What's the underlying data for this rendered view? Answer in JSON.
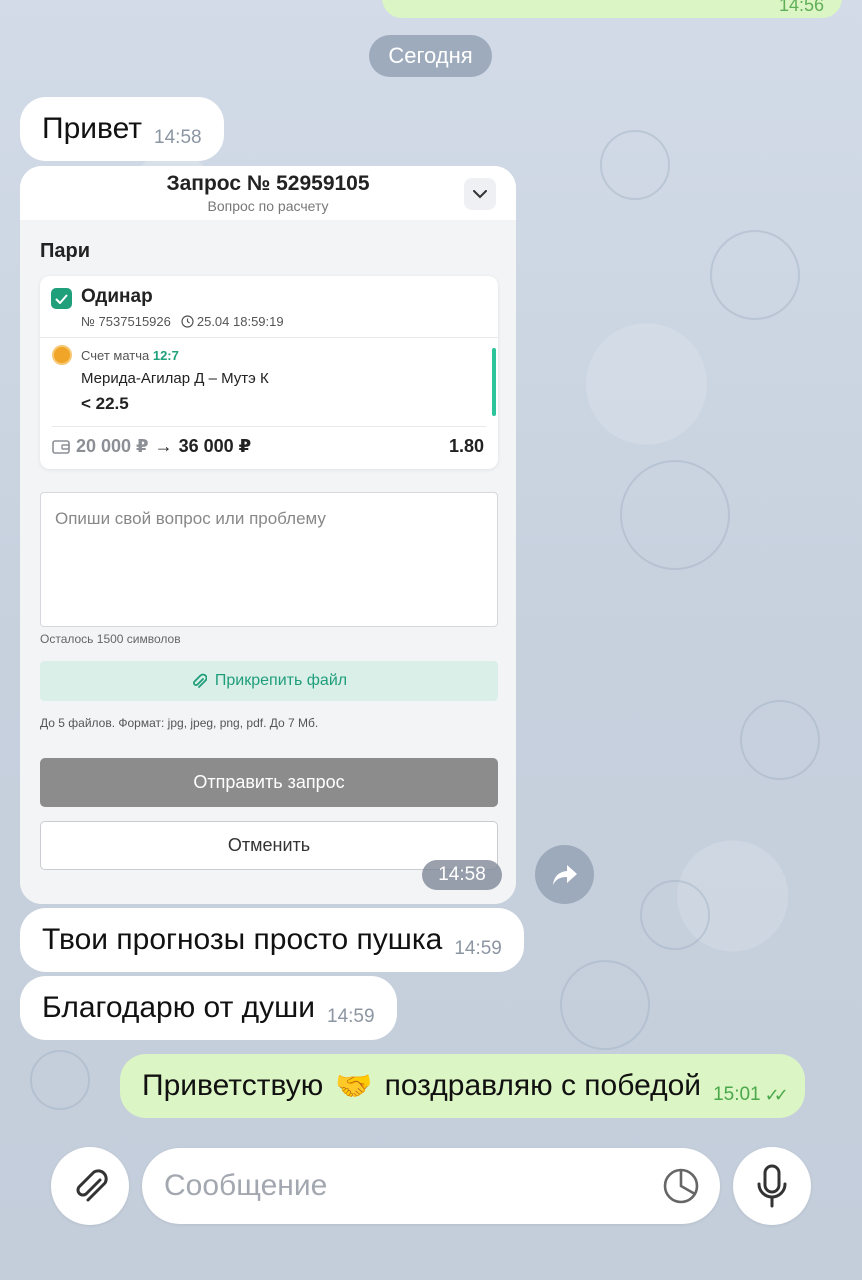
{
  "chat": {
    "top_partial_time": "14:56",
    "date_separator": "Сегодня",
    "messages": {
      "m1": {
        "text": "Привет",
        "time": "14:58"
      },
      "m3": {
        "text": "Твои прогнозы просто пушка",
        "time": "14:59"
      },
      "m4": {
        "text": "Благодарю от души",
        "time": "14:59"
      },
      "m5": {
        "text_before": "Приветствую",
        "emoji": "🤝",
        "text_after": "поздравляю с победой",
        "time": "15:01"
      }
    },
    "card_time": "14:58"
  },
  "card": {
    "title": "Запрос № 52959105",
    "subtitle": "Вопрос по расчету",
    "section_title": "Пари",
    "bet": {
      "type": "Одинар",
      "number": "№ 7537515926",
      "datetime": "25.04 18:59:19",
      "market_label": "Счет матча",
      "market_score": "12:7",
      "event": "Мерида-Агилар Д – Мутэ К",
      "outcome": "< 22.5",
      "stake": "20 000 ₽",
      "arrow": "→",
      "payout": "36 000 ₽",
      "coefficient": "1.80"
    },
    "textarea_placeholder": "Опиши свой вопрос или проблему",
    "remaining_chars": "Осталось 1500 символов",
    "attach_label": "Прикрепить файл",
    "file_hint": "До 5 файлов. Формат: jpg, jpeg, png, pdf. До 7 Мб.",
    "send_label": "Отправить запрос",
    "cancel_label": "Отменить"
  },
  "input_bar": {
    "placeholder": "Сообщение"
  },
  "icons": {
    "attach": "paperclip-icon",
    "sticker": "sticker-icon",
    "mic": "microphone-icon",
    "forward": "forward-arrow-icon",
    "chevron": "chevron-down-icon"
  },
  "colors": {
    "accent_green": "#1fa07b",
    "outgoing_bubble": "#dcf5c4",
    "read_check": "#4aa84b"
  }
}
